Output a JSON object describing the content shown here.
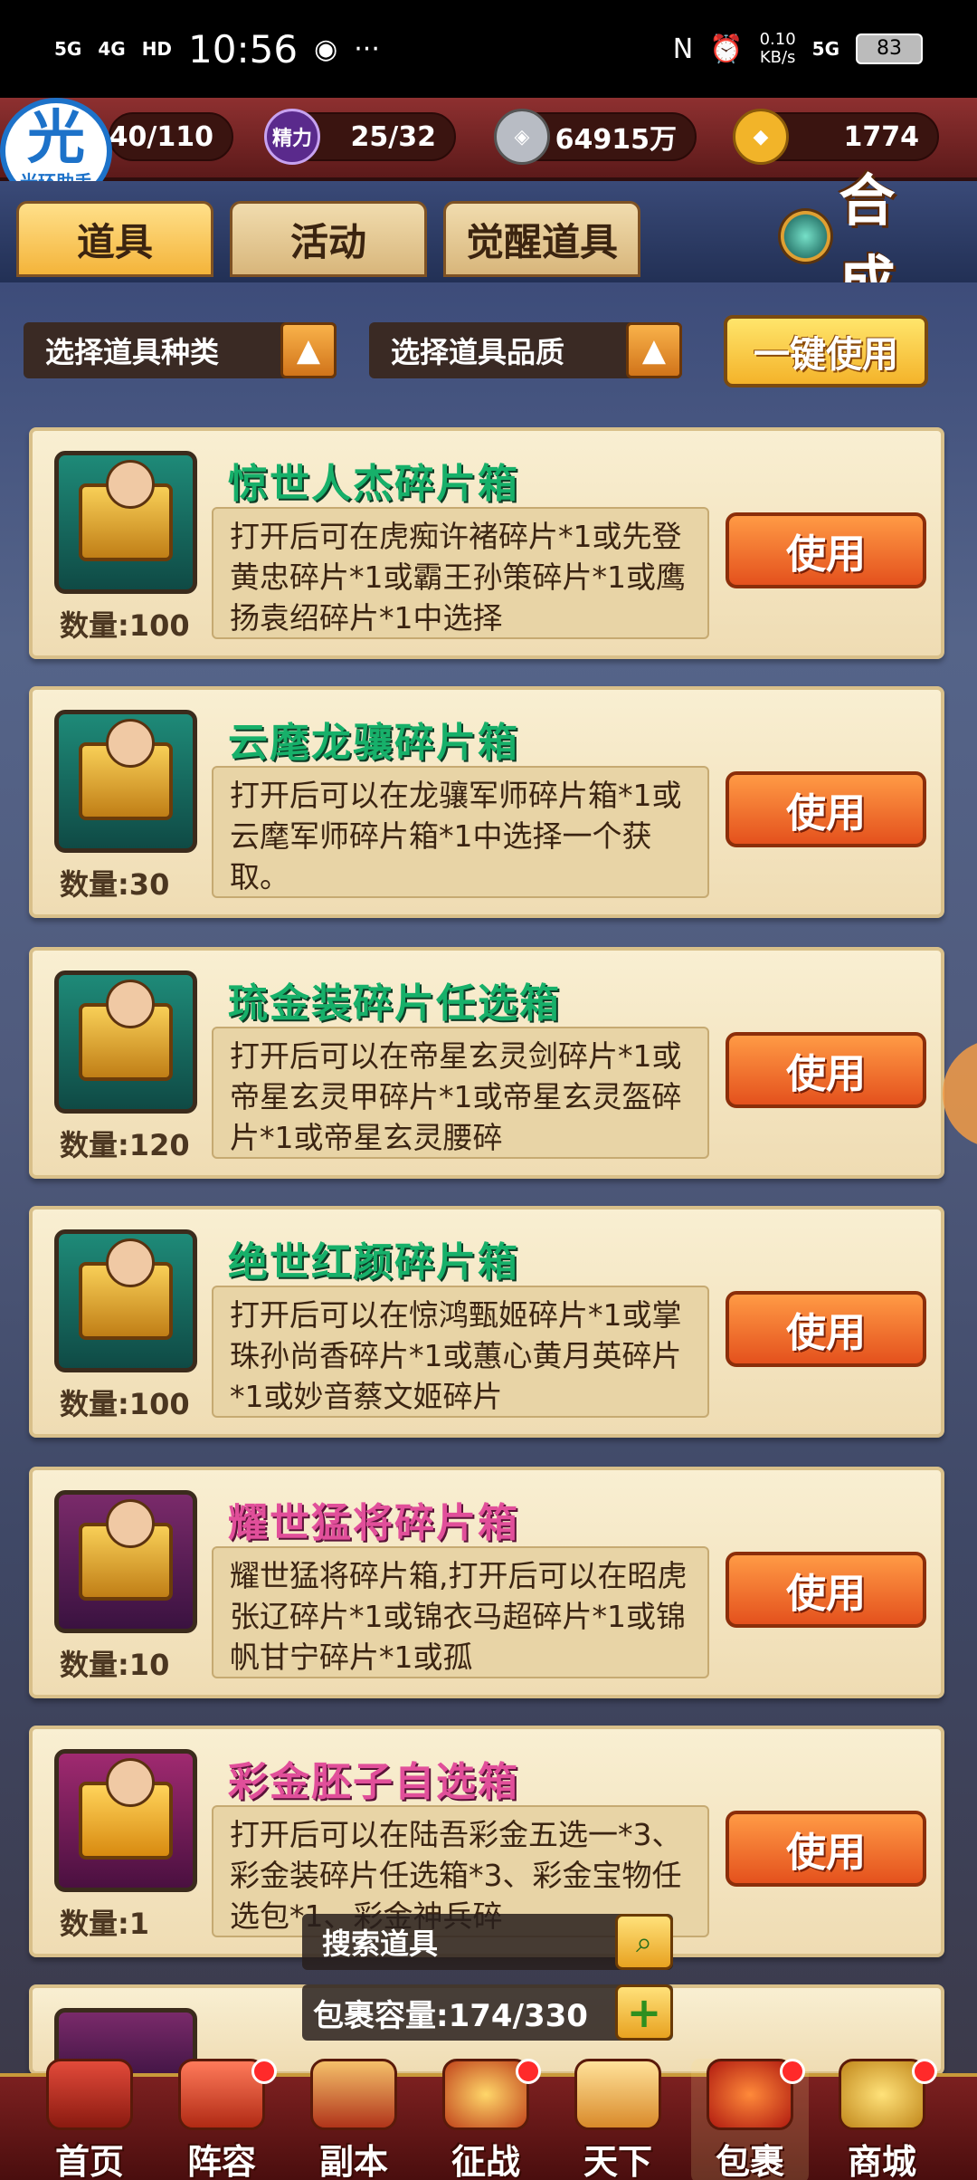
{
  "status_bar": {
    "signal1": "5G",
    "signal2": "4G",
    "hd": "HD",
    "time": "10:56",
    "more": "···",
    "net_speed": "0.10",
    "net_unit": "KB/s",
    "signal3": "5G",
    "battery": "83"
  },
  "resources": {
    "badge_main": "光",
    "badge_sub": "光环助手",
    "stamina": "40/110",
    "energy_icon": "精力",
    "energy": "25/32",
    "silver": "64915万",
    "gold": "1774"
  },
  "tabs": [
    {
      "label": "道具",
      "active": true
    },
    {
      "label": "活动",
      "active": false
    },
    {
      "label": "觉醒道具",
      "active": false
    }
  ],
  "synth_label": "合成",
  "filters": {
    "type": "选择道具种类",
    "quality": "选择道具品质",
    "one_key": "一键使用"
  },
  "items": [
    {
      "title": "惊世人杰碎片箱",
      "qty": "数量:100",
      "desc": "打开后可在虎痴许褚碎片*1或先登黄忠碎片*1或霸王孙策碎片*1或鹰扬袁绍碎片*1中选择",
      "use": "使用"
    },
    {
      "title": "云麾龙骧碎片箱",
      "qty": "数量:30",
      "desc": "打开后可以在龙骧军师碎片箱*1或云麾军师碎片箱*1中选择一个获取。",
      "use": "使用"
    },
    {
      "title": "琉金装碎片任选箱",
      "qty": "数量:120",
      "desc": "打开后可以在帝星玄灵剑碎片*1或帝星玄灵甲碎片*1或帝星玄灵盔碎片*1或帝星玄灵腰碎",
      "use": "使用"
    },
    {
      "title": "绝世红颜碎片箱",
      "qty": "数量:100",
      "desc": "打开后可以在惊鸿甄姬碎片*1或掌珠孙尚香碎片*1或蕙心黄月英碎片*1或妙音蔡文姬碎片",
      "use": "使用"
    },
    {
      "title": "耀世猛将碎片箱",
      "qty": "数量:10",
      "desc": "耀世猛将碎片箱,打开后可以在昭虎张辽碎片*1或锦衣马超碎片*1或锦帆甘宁碎片*1或孤",
      "use": "使用"
    },
    {
      "title": "彩金胚子自选箱",
      "qty": "数量:1",
      "desc": "打开后可以在陆吾彩金五选一*3、彩金装碎片任选箱*3、彩金宝物任选包*1、彩金神兵碎",
      "use": "使用"
    }
  ],
  "search_placeholder": "搜索道具",
  "capacity": "包裹容量:174/330",
  "nav": [
    {
      "label": "首页"
    },
    {
      "label": "阵容"
    },
    {
      "label": "副本"
    },
    {
      "label": "征战"
    },
    {
      "label": "天下"
    },
    {
      "label": "包裹"
    },
    {
      "label": "商城"
    }
  ],
  "colors": {
    "accent_orange": "#e4511d",
    "title_green": "#17b06a",
    "title_pink": "#e14f9a",
    "card_bg": "#f9efd2"
  }
}
